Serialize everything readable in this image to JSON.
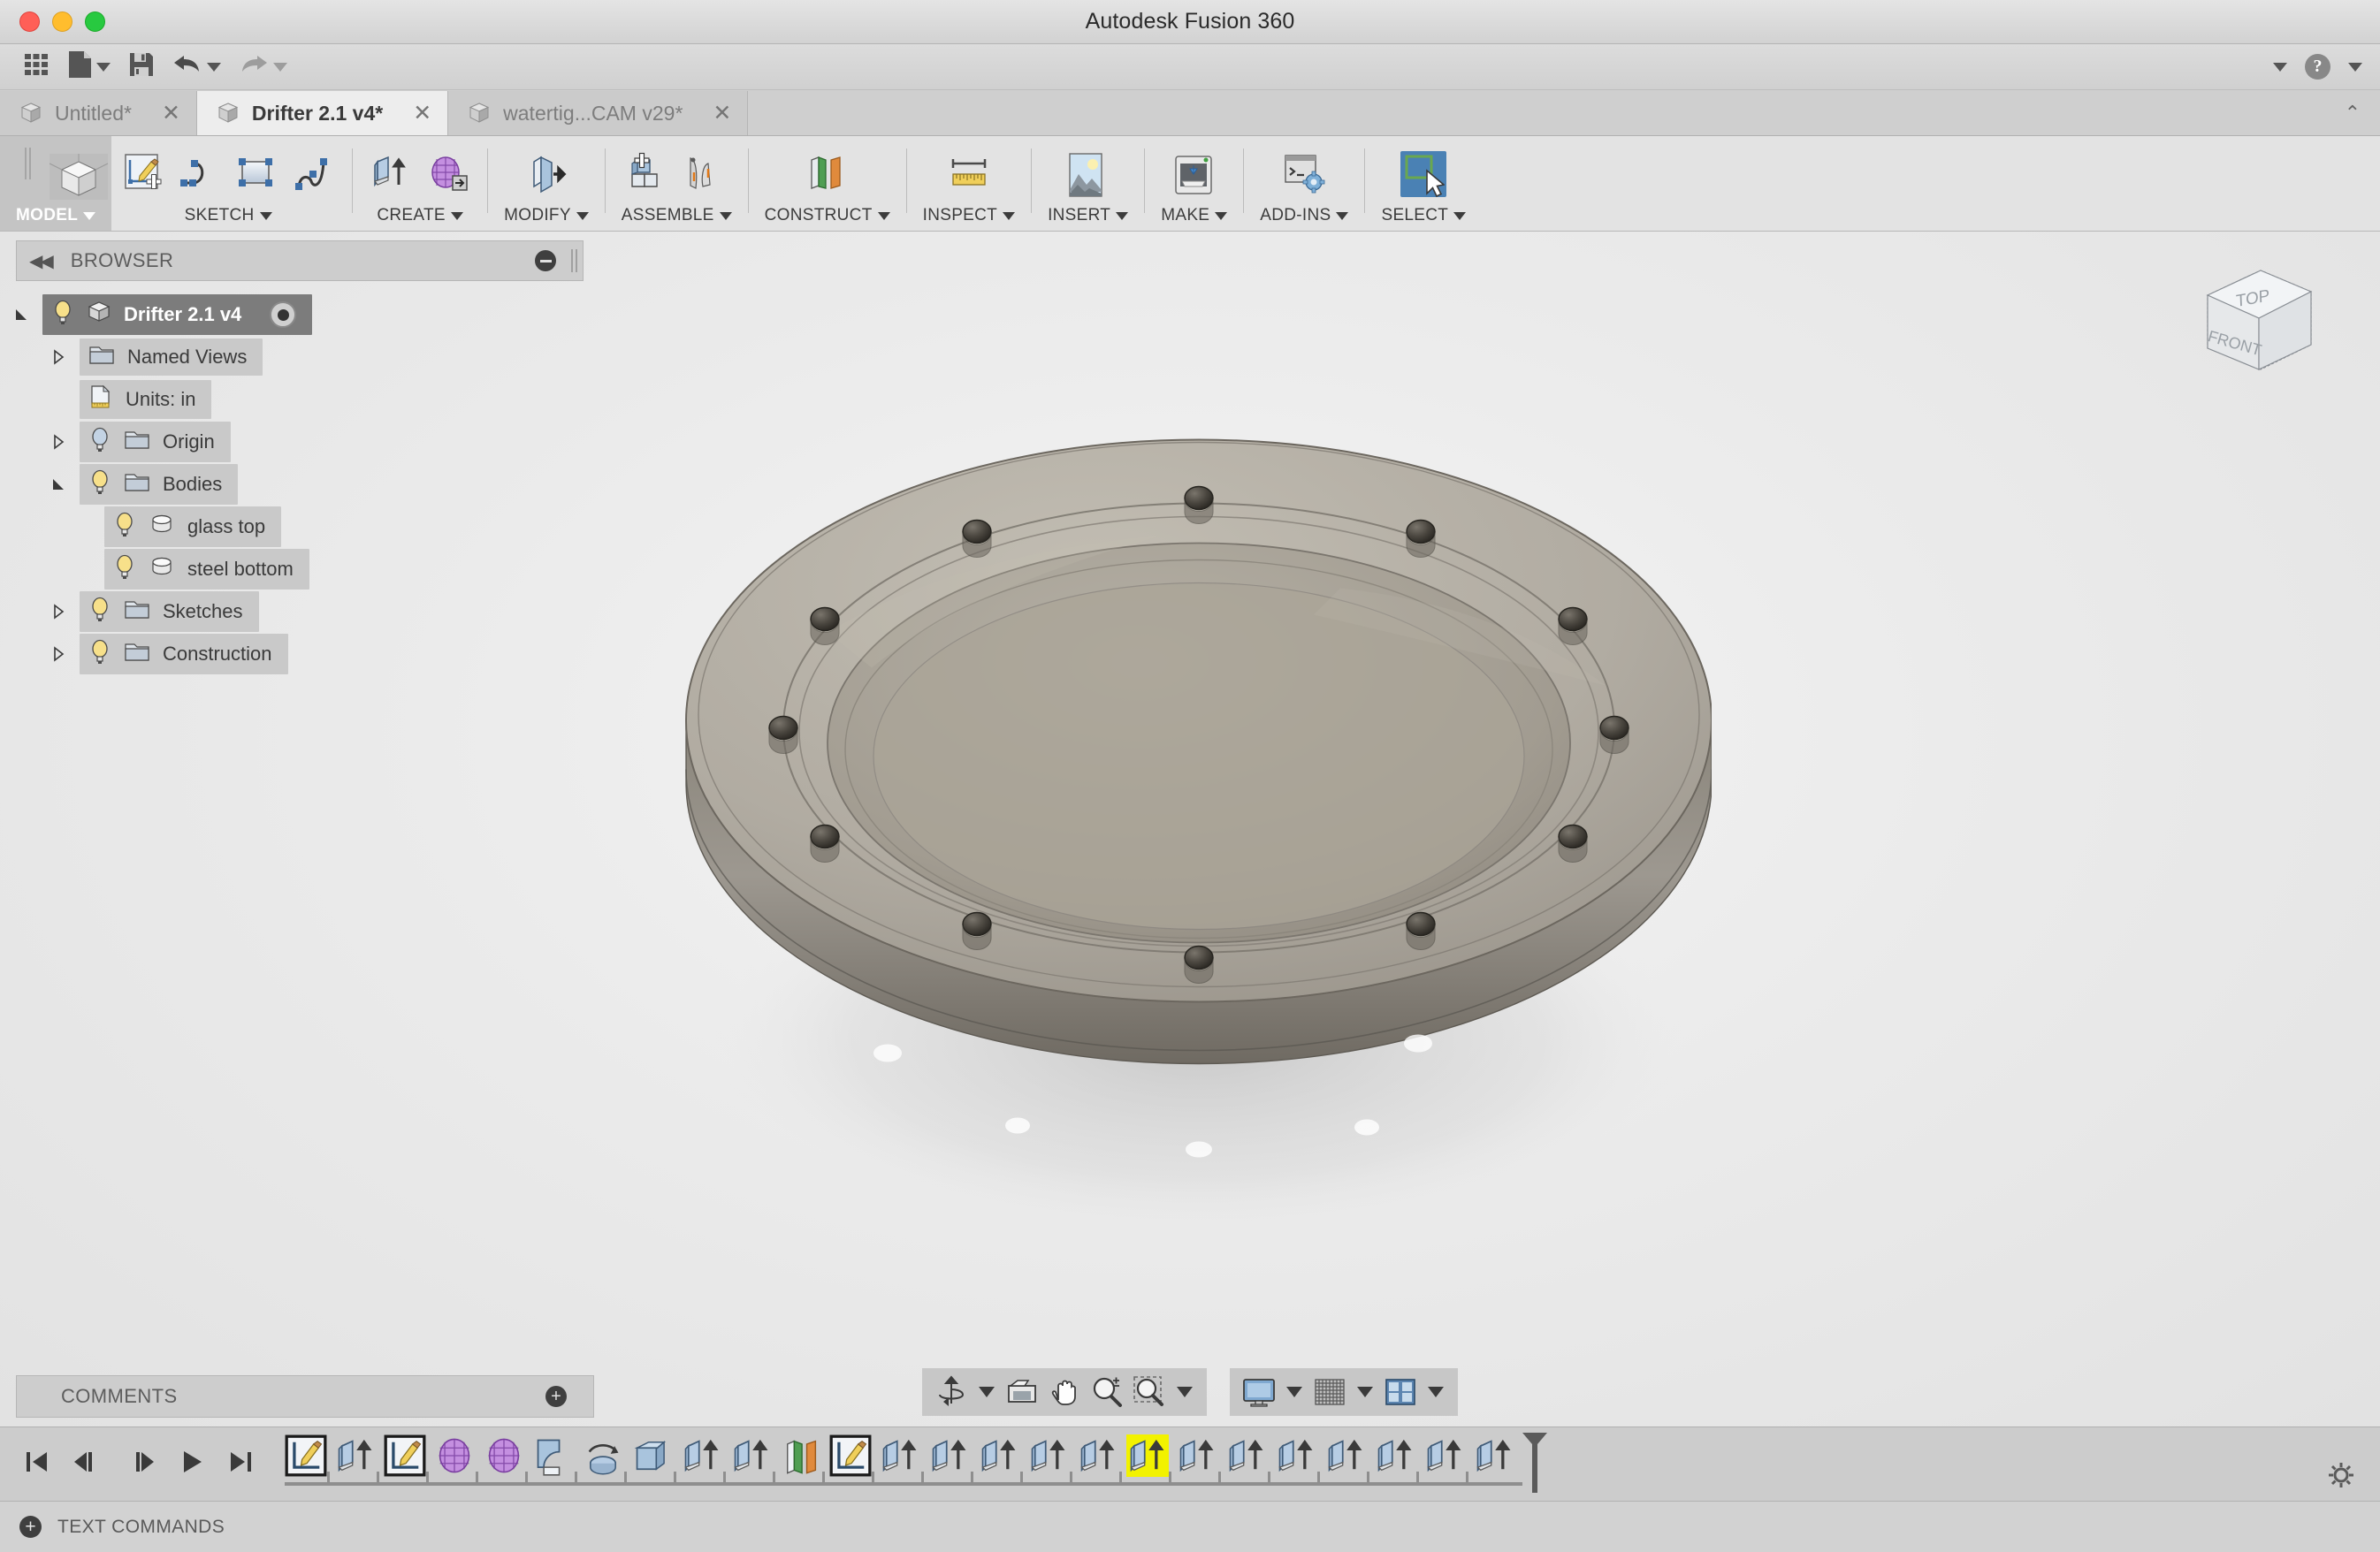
{
  "window": {
    "title": "Autodesk Fusion 360",
    "controls": [
      "close",
      "minimize",
      "maximize"
    ]
  },
  "quick_access": {
    "items": [
      {
        "name": "app-grid-icon",
        "label": "Show Data Panel"
      },
      {
        "name": "new-file-icon",
        "label": "New Design",
        "caret": true
      },
      {
        "name": "save-icon",
        "label": "Save"
      },
      {
        "name": "undo-icon",
        "label": "Undo",
        "caret": true
      },
      {
        "name": "redo-icon",
        "label": "Redo",
        "caret": true
      }
    ],
    "right": [
      {
        "name": "account-caret-icon",
        "label": ""
      },
      {
        "name": "help-icon",
        "label": "?"
      },
      {
        "name": "help-caret-icon",
        "label": ""
      }
    ]
  },
  "tabs": [
    {
      "label": "Untitled*",
      "active": false,
      "closable": true
    },
    {
      "label": "Drifter 2.1 v4*",
      "active": true,
      "closable": true
    },
    {
      "label": "watertig...CAM v29*",
      "active": false,
      "closable": true
    }
  ],
  "ribbon": {
    "panels": [
      {
        "label": "MODEL",
        "active": true,
        "icons": [
          "model-cube-icon"
        ]
      },
      {
        "label": "SKETCH",
        "active": false,
        "icons": [
          "create-sketch-icon",
          "arc-icon",
          "rectangle-icon",
          "spline-icon"
        ]
      },
      {
        "label": "CREATE",
        "active": false,
        "icons": [
          "extrude-icon",
          "create-form-icon"
        ]
      },
      {
        "label": "MODIFY",
        "active": false,
        "icons": [
          "press-pull-icon"
        ]
      },
      {
        "label": "ASSEMBLE",
        "active": false,
        "icons": [
          "new-component-icon",
          "joint-icon"
        ]
      },
      {
        "label": "CONSTRUCT",
        "active": false,
        "icons": [
          "offset-plane-icon"
        ]
      },
      {
        "label": "INSPECT",
        "active": false,
        "icons": [
          "measure-icon"
        ]
      },
      {
        "label": "INSERT",
        "active": false,
        "icons": [
          "insert-image-icon"
        ]
      },
      {
        "label": "MAKE",
        "active": false,
        "icons": [
          "3d-print-icon"
        ]
      },
      {
        "label": "ADD-INS",
        "active": false,
        "icons": [
          "scripts-addins-icon"
        ]
      },
      {
        "label": "SELECT",
        "active": false,
        "selected_icon": true,
        "icons": [
          "select-window-icon"
        ]
      }
    ]
  },
  "browser": {
    "title": "BROWSER",
    "collapse_icon": "collapse-left-icon",
    "minimize_icon": "minus-circle-icon",
    "tree": [
      {
        "label": "Drifter 2.1 v4",
        "level": 0,
        "twisty": "expanded",
        "bulb": "on",
        "icon": "component-cube-icon",
        "selected": true,
        "radio": true
      },
      {
        "label": "Named Views",
        "level": 1,
        "twisty": "collapsed",
        "bulb": "none",
        "icon": "folder-icon",
        "selected": false,
        "radio": false
      },
      {
        "label": "Units: in",
        "level": 1,
        "twisty": "none",
        "bulb": "none",
        "icon": "units-doc-icon",
        "selected": false,
        "radio": false
      },
      {
        "label": "Origin",
        "level": 1,
        "twisty": "collapsed",
        "bulb": "off",
        "icon": "folder-icon",
        "selected": false,
        "radio": false
      },
      {
        "label": "Bodies",
        "level": 1,
        "twisty": "expanded",
        "bulb": "on",
        "icon": "folder-icon",
        "selected": false,
        "radio": false
      },
      {
        "label": "glass top",
        "level": 2,
        "twisty": "none",
        "bulb": "on",
        "icon": "body-icon",
        "selected": false,
        "radio": false
      },
      {
        "label": "steel bottom",
        "level": 2,
        "twisty": "none",
        "bulb": "on",
        "icon": "body-icon",
        "selected": false,
        "radio": false
      },
      {
        "label": "Sketches",
        "level": 1,
        "twisty": "collapsed",
        "bulb": "on",
        "icon": "folder-icon",
        "selected": false,
        "radio": false
      },
      {
        "label": "Construction",
        "level": 1,
        "twisty": "collapsed",
        "bulb": "on",
        "icon": "folder-icon",
        "selected": false,
        "radio": false
      }
    ]
  },
  "comments": {
    "title": "COMMENTS",
    "add_icon": "plus-circle-icon"
  },
  "viewcube": {
    "top_face": "TOP",
    "front_face": "FRONT"
  },
  "navbar": {
    "group1": [
      {
        "name": "orbit-icon",
        "caret": true
      },
      {
        "name": "look-at-icon",
        "caret": false
      },
      {
        "name": "pan-icon",
        "caret": false
      },
      {
        "name": "zoom-icon",
        "caret": false
      },
      {
        "name": "zoom-window-icon",
        "caret": true
      }
    ],
    "group2": [
      {
        "name": "display-settings-icon",
        "caret": true
      },
      {
        "name": "grid-snaps-icon",
        "caret": true
      },
      {
        "name": "viewports-icon",
        "caret": true
      }
    ]
  },
  "timeline": {
    "playback": [
      "go-to-beginning-icon",
      "step-back-icon",
      "step-forward-icon",
      "play-icon",
      "go-to-end-icon"
    ],
    "features": [
      {
        "type": "sketch-icon",
        "highlighted": false
      },
      {
        "type": "extrude-icon",
        "highlighted": false
      },
      {
        "type": "sketch-icon",
        "highlighted": false
      },
      {
        "type": "form-icon",
        "highlighted": false
      },
      {
        "type": "form-icon",
        "highlighted": false
      },
      {
        "type": "fillet-icon",
        "highlighted": false
      },
      {
        "type": "revolve-icon",
        "highlighted": false
      },
      {
        "type": "shell-icon",
        "highlighted": false
      },
      {
        "type": "extrude-icon",
        "highlighted": false
      },
      {
        "type": "extrude-icon",
        "highlighted": false
      },
      {
        "type": "plane-icon",
        "highlighted": false
      },
      {
        "type": "sketch-icon",
        "highlighted": false
      },
      {
        "type": "extrude-icon",
        "highlighted": false
      },
      {
        "type": "extrude-icon",
        "highlighted": false
      },
      {
        "type": "extrude-icon",
        "highlighted": false
      },
      {
        "type": "extrude-icon",
        "highlighted": false
      },
      {
        "type": "extrude-icon",
        "highlighted": false
      },
      {
        "type": "extrude-icon",
        "highlighted": true
      },
      {
        "type": "extrude-icon",
        "highlighted": false
      },
      {
        "type": "extrude-icon",
        "highlighted": false
      },
      {
        "type": "extrude-icon",
        "highlighted": false
      },
      {
        "type": "extrude-icon",
        "highlighted": false
      },
      {
        "type": "extrude-icon",
        "highlighted": false
      },
      {
        "type": "extrude-icon",
        "highlighted": false
      },
      {
        "type": "extrude-icon",
        "highlighted": false
      }
    ],
    "settings_icon": "timeline-settings-icon"
  },
  "statusbar": {
    "label": "TEXT COMMANDS",
    "icon": "plus-circle-icon"
  },
  "model": {
    "description": "Circular watertight enclosure with glass top and steel bottom",
    "bolt_count": 12,
    "body_color": "#a39d92",
    "glass_color": "#b4afa4"
  }
}
